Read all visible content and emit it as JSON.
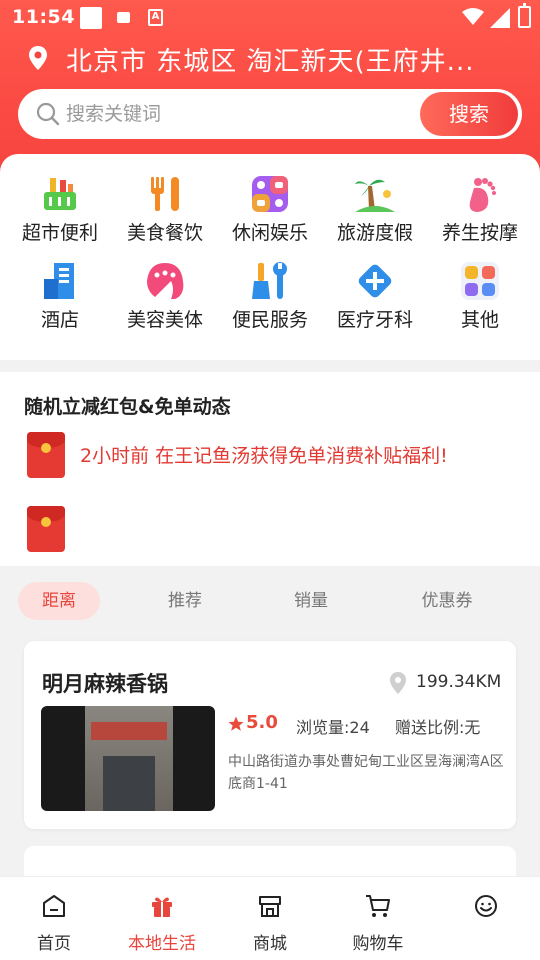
{
  "status_bar": {
    "time": "11:54"
  },
  "location": {
    "text": "北京市 东城区 淘汇新天(王府井..."
  },
  "search": {
    "placeholder": "搜索关键词",
    "button_label": "搜索"
  },
  "categories": [
    {
      "label": "超市便利",
      "icon": "supermarket-basket-icon"
    },
    {
      "label": "美食餐饮",
      "icon": "fork-knife-icon"
    },
    {
      "label": "休闲娱乐",
      "icon": "entertainment-icon"
    },
    {
      "label": "旅游度假",
      "icon": "palm-tree-icon"
    },
    {
      "label": "养生按摩",
      "icon": "footprint-icon"
    },
    {
      "label": "酒店",
      "icon": "hotel-building-icon"
    },
    {
      "label": "美容美体",
      "icon": "beauty-hair-icon"
    },
    {
      "label": "便民服务",
      "icon": "tools-icon"
    },
    {
      "label": "医疗牙科",
      "icon": "medical-cross-icon"
    },
    {
      "label": "其他",
      "icon": "grid-apps-icon"
    }
  ],
  "dynamics": {
    "title": "随机立减红包&免单动态",
    "messages": [
      "2小时前 在王记鱼汤获得免单消费补贴福利!"
    ]
  },
  "tabs": [
    {
      "label": "距离",
      "active": true
    },
    {
      "label": "推荐",
      "active": false
    },
    {
      "label": "销量",
      "active": false
    },
    {
      "label": "优惠券",
      "active": false
    }
  ],
  "shop": {
    "name": "明月麻辣香锅",
    "distance": "199.34KM",
    "rating": "5.0",
    "views": "浏览量:24",
    "ratio": "赠送比例:无",
    "address": "中山路街道办事处曹妃甸工业区昱海澜湾A区底商1-41"
  },
  "bottom_nav": [
    {
      "label": "首页",
      "icon": "home-icon",
      "active": false
    },
    {
      "label": "本地生活",
      "icon": "gift-icon",
      "active": true
    },
    {
      "label": "商城",
      "icon": "store-icon",
      "active": false
    },
    {
      "label": "购物车",
      "icon": "cart-icon",
      "active": false
    },
    {
      "label": "",
      "icon": "smiley-icon",
      "active": false
    }
  ],
  "colors": {
    "primary": "#f6453f",
    "accent_text": "#e23a33",
    "tab_active_bg": "#fde0dd"
  }
}
